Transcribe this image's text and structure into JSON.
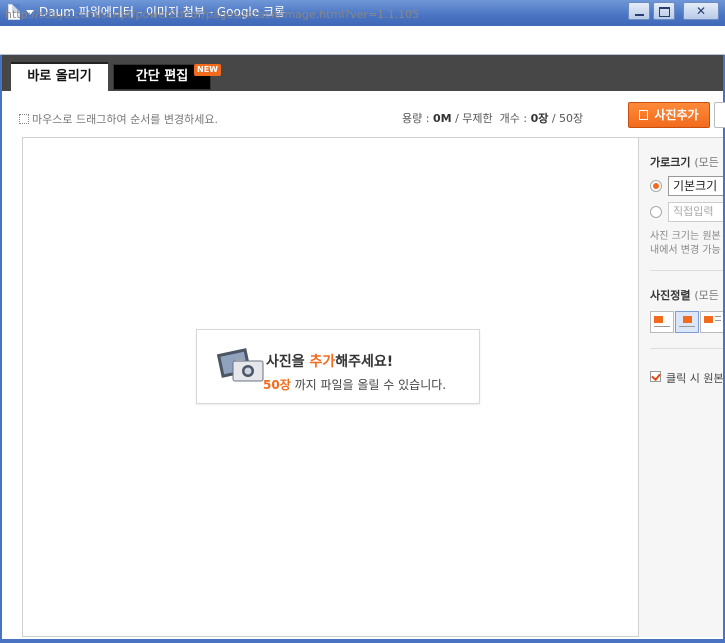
{
  "window": {
    "title": "Daum 파워에디터 - 이미지 첨부 - Google 크롬",
    "close_glyph": "✕"
  },
  "urlbar": {
    "url": "http://sdayz.com/script/powerEditor/pages/attach/image.html?ver=1.1.105"
  },
  "tabs": {
    "basic": "바로 올리기",
    "edit": "간단 편집",
    "new_badge": "NEW"
  },
  "toolbar": {
    "drag_hint": "마우스로 드래그하여 순서를 변경하세요.",
    "capacity_label": "용량 :",
    "capacity_value": "0M",
    "capacity_limit": "/ 무제한",
    "count_label": "개수 :",
    "count_value": "0장",
    "count_max": "/ 50장",
    "add_photo_label": "사진추가"
  },
  "empty_state": {
    "title_prefix": "사진을 ",
    "title_accent": "추가",
    "title_suffix": "해주세요!",
    "sub_number": "50장",
    "sub_text": " 까지 파일을 올릴 수 있습니다."
  },
  "sidebar": {
    "size_title": "가로크기",
    "size_title_note": "(모든",
    "size_default": "기본크기",
    "size_custom_placeholder": "직접입력",
    "size_note_line1": "사진 크기는 원본",
    "size_note_line2": "내에서 변경 가능",
    "align_title": "사진정렬",
    "align_title_note": "(모든",
    "original_click_label": "클릭 시 원본"
  },
  "colors": {
    "accent": "#f26b1d",
    "tabbar": "#474747",
    "titlebar": "#4a73c2"
  }
}
